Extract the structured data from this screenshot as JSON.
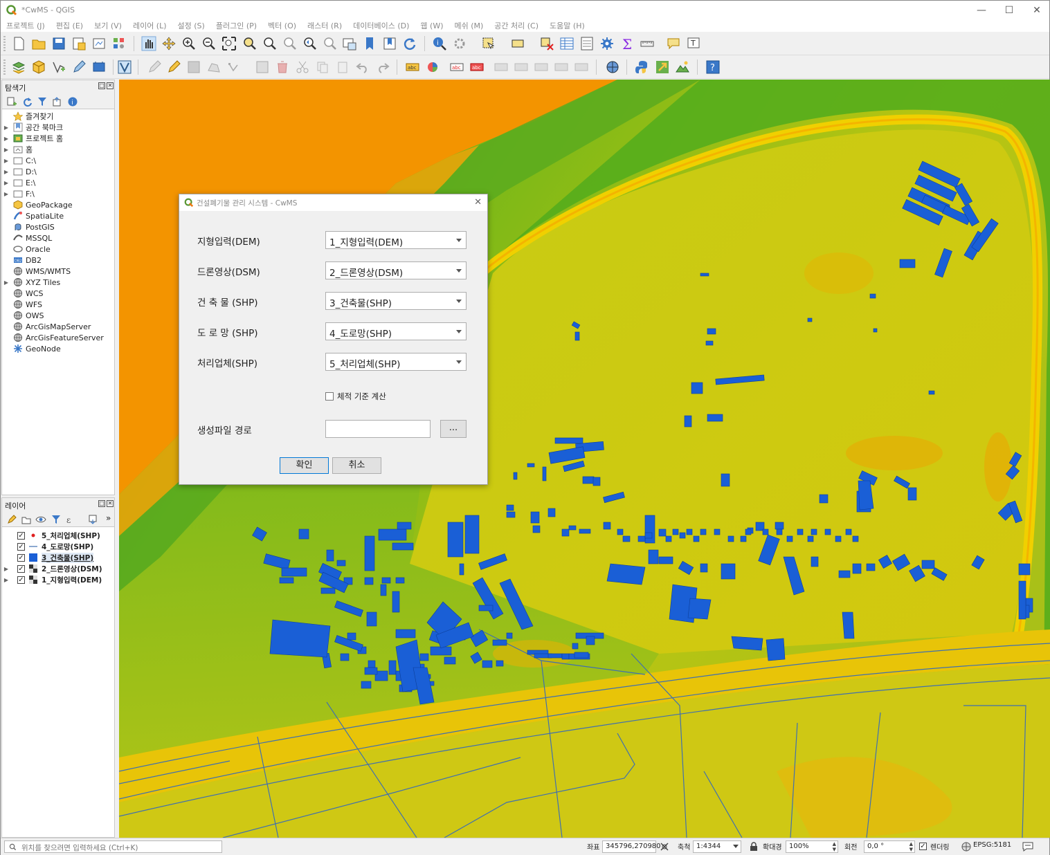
{
  "window": {
    "title": "*CwMS - QGIS"
  },
  "menu": [
    "프로젝트 (J)",
    "편집 (E)",
    "보기 (V)",
    "레이어 (L)",
    "설정 (S)",
    "플러그인 (P)",
    "벡터 (O)",
    "래스터 (R)",
    "데이터베이스 (D)",
    "웹 (W)",
    "메쉬 (M)",
    "공간 처리 (C)",
    "도움말 (H)"
  ],
  "browser": {
    "title": "탐색기",
    "items": [
      {
        "label": "즐겨찾기",
        "icon": "star-icon",
        "expandable": false
      },
      {
        "label": "공간 북마크",
        "icon": "bookmark-icon",
        "expandable": true
      },
      {
        "label": "프로젝트 홈",
        "icon": "project-home-icon",
        "expandable": true
      },
      {
        "label": "홈",
        "icon": "home-folder-icon",
        "expandable": true
      },
      {
        "label": "C:\\",
        "icon": "drive-icon",
        "expandable": true
      },
      {
        "label": "D:\\",
        "icon": "drive-icon",
        "expandable": true
      },
      {
        "label": "E:\\",
        "icon": "drive-icon",
        "expandable": true
      },
      {
        "label": "F:\\",
        "icon": "drive-icon",
        "expandable": true
      },
      {
        "label": "GeoPackage",
        "icon": "geopackage-icon",
        "expandable": false
      },
      {
        "label": "SpatiaLite",
        "icon": "spatialite-icon",
        "expandable": false
      },
      {
        "label": "PostGIS",
        "icon": "postgis-icon",
        "expandable": false
      },
      {
        "label": "MSSQL",
        "icon": "mssql-icon",
        "expandable": false
      },
      {
        "label": "Oracle",
        "icon": "oracle-icon",
        "expandable": false
      },
      {
        "label": "DB2",
        "icon": "db2-icon",
        "expandable": false
      },
      {
        "label": "WMS/WMTS",
        "icon": "globe-icon",
        "expandable": false
      },
      {
        "label": "XYZ Tiles",
        "icon": "globe-icon",
        "expandable": true
      },
      {
        "label": "WCS",
        "icon": "globe-icon",
        "expandable": false
      },
      {
        "label": "WFS",
        "icon": "globe-icon",
        "expandable": false
      },
      {
        "label": "OWS",
        "icon": "globe-icon",
        "expandable": false
      },
      {
        "label": "ArcGisMapServer",
        "icon": "globe-icon",
        "expandable": false
      },
      {
        "label": "ArcGisFeatureServer",
        "icon": "globe-icon",
        "expandable": false
      },
      {
        "label": "GeoNode",
        "icon": "geonode-icon",
        "expandable": false
      }
    ]
  },
  "layers": {
    "title": "레이어",
    "items": [
      {
        "label": "5_처리업체(SHP)",
        "checked": true,
        "symbol": "point",
        "selected": false
      },
      {
        "label": "4_도로망(SHP)",
        "checked": true,
        "symbol": "line",
        "selected": false
      },
      {
        "label": "3_건축물(SHP)",
        "checked": true,
        "symbol": "polygon",
        "selected": true
      },
      {
        "label": "2_드론영상(DSM)",
        "checked": true,
        "symbol": "raster",
        "selected": false
      },
      {
        "label": "1_지형입력(DEM)",
        "checked": true,
        "symbol": "raster",
        "selected": false
      }
    ]
  },
  "dialog": {
    "title": "건설폐기물 관리 시스템 - CwMS",
    "fields": [
      {
        "label": "지형입력(DEM)",
        "value": "1_지형입력(DEM)"
      },
      {
        "label": "드론영상(DSM)",
        "value": "2_드론영상(DSM)"
      },
      {
        "label": "건 축 물 (SHP)",
        "value": "3_건축물(SHP)"
      },
      {
        "label": "도 로 망 (SHP)",
        "value": "4_도로망(SHP)"
      },
      {
        "label": "처리업체(SHP)",
        "value": "5_처리업체(SHP)"
      }
    ],
    "volume_checkbox": {
      "label": "체적 기준 계산",
      "checked": false
    },
    "output_path": {
      "label": "생성파일 경로",
      "value": "",
      "browse_label": "..."
    },
    "ok_label": "확인",
    "cancel_label": "취소"
  },
  "status": {
    "locator_placeholder": "위치를 찾으려면 입력하세요 (Ctrl+K)",
    "coord_label": "좌표",
    "coord_value": "345796,270980",
    "scale_label": "축척",
    "scale_value": "1:4344",
    "magnifier_label": "확대경",
    "magnifier_value": "100%",
    "rotation_label": "회전",
    "rotation_value": "0,0 °",
    "render_label": "렌더링",
    "crs_label": "EPSG:5181"
  },
  "colors": {
    "building_fill": "#1a5fd6",
    "road_line": "#3a6fb0",
    "dem_low": "#2aa02a",
    "dem_mid": "#c8cc10",
    "dem_high": "#f09000"
  }
}
